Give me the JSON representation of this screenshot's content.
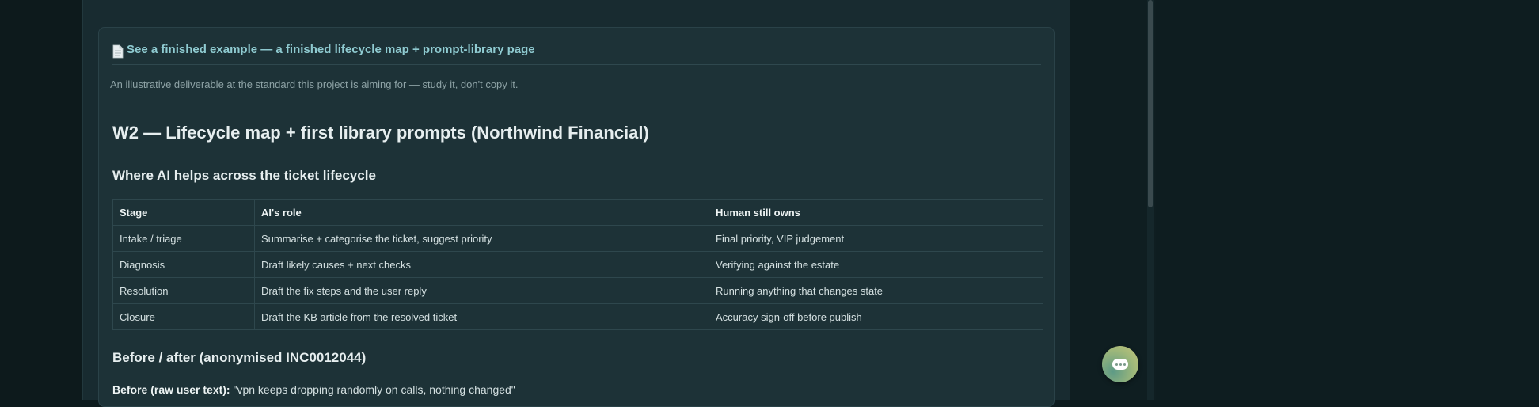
{
  "example_card": {
    "link_label": "See a finished example — a finished lifecycle map + prompt-library page",
    "description": "An illustrative deliverable at the standard this project is aiming for — study it, don't copy it.",
    "icon": "document-icon"
  },
  "document": {
    "title": "W2 — Lifecycle map + first library prompts (Northwind Financial)",
    "lifecycle_heading": "Where AI helps across the ticket lifecycle",
    "table": {
      "headers": [
        "Stage",
        "AI's role",
        "Human still owns"
      ],
      "rows": [
        [
          "Intake / triage",
          "Summarise + categorise the ticket, suggest priority",
          "Final priority, VIP judgement"
        ],
        [
          "Diagnosis",
          "Draft likely causes + next checks",
          "Verifying against the estate"
        ],
        [
          "Resolution",
          "Draft the fix steps and the user reply",
          "Running anything that changes state"
        ],
        [
          "Closure",
          "Draft the KB article from the resolved ticket",
          "Accuracy sign-off before publish"
        ]
      ]
    },
    "before_after_heading": "Before / after (anonymised INC0012044)",
    "before_label": "Before (raw user text):",
    "before_text": "\"vpn keeps dropping randomly on calls, nothing changed\""
  },
  "chat": {
    "icon": "chat-icon"
  }
}
